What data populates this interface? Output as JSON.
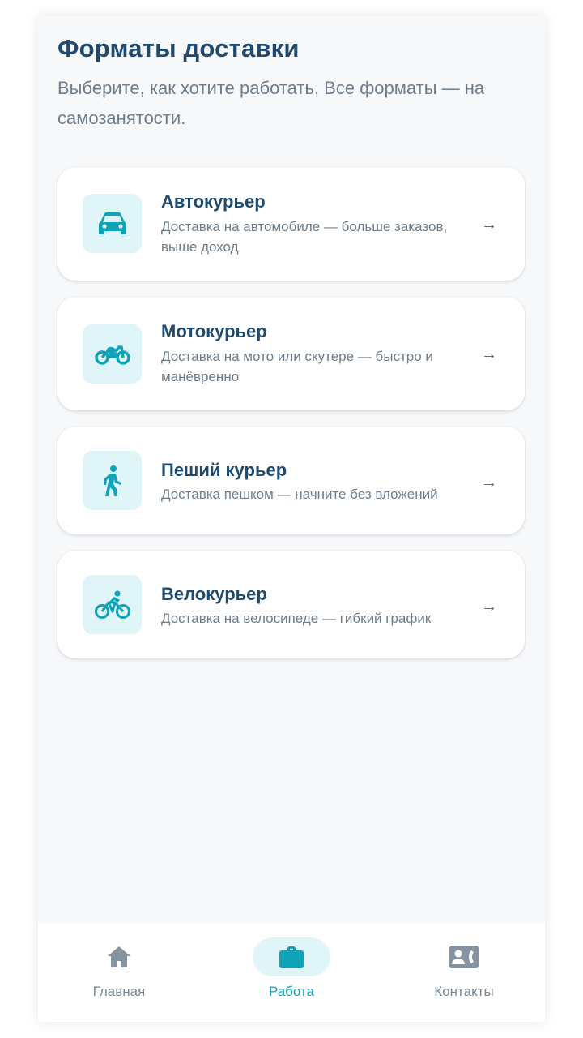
{
  "header": {
    "title": "Форматы доставки",
    "subtitle": "Выберите, как хотите работать. Все форматы — на самозанятости."
  },
  "formats": [
    {
      "title": "Автокурьер",
      "description": "Доставка на автомобиле — больше заказов, выше доход",
      "icon": "car-icon",
      "arrow": "→"
    },
    {
      "title": "Мотокурьер",
      "description": "Доставка на мото или скутере — быстро и манёвренно",
      "icon": "motorcycle-icon",
      "arrow": "→"
    },
    {
      "title": "Пеший курьер",
      "description": "Доставка пешком — начните без вложений",
      "icon": "walking-person-icon",
      "arrow": "→"
    },
    {
      "title": "Велокурьер",
      "description": "Доставка на велосипеде — гибкий график",
      "icon": "bicycle-icon",
      "arrow": "→"
    }
  ],
  "nav": {
    "items": [
      {
        "label": "Главная",
        "icon": "home-icon",
        "active": false
      },
      {
        "label": "Работа",
        "icon": "briefcase-icon",
        "active": true
      },
      {
        "label": "Контакты",
        "icon": "contacts-icon",
        "active": false
      }
    ]
  },
  "colors": {
    "accent": "#0fa3b8",
    "title": "#1f4a6e",
    "text_muted": "#6d7d8b",
    "icon_bg": "#dff5f8",
    "nav_inactive": "#7a8896"
  }
}
